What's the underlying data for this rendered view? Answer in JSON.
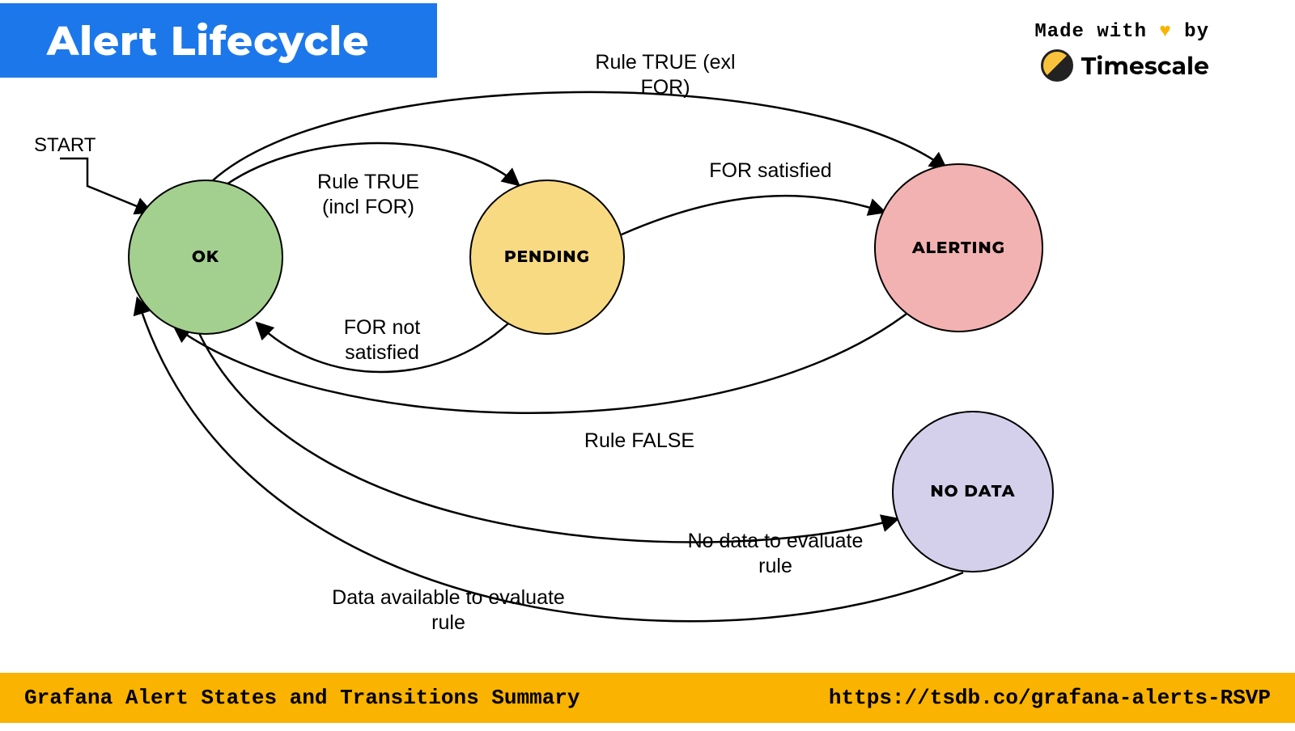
{
  "title": "Alert Lifecycle",
  "attribution": {
    "made_prefix": "Made with ",
    "made_suffix": " by",
    "brand": "Timescale"
  },
  "states": {
    "ok": "OK",
    "pending": "PENDING",
    "alerting": "ALERTING",
    "nodata": "NO DATA"
  },
  "labels": {
    "start": "START",
    "rule_true_incl": "Rule TRUE (incl FOR)",
    "rule_true_exl": "Rule TRUE (exl FOR)",
    "for_satisfied": "FOR satisfied",
    "for_not_satisfied": "FOR not satisfied",
    "rule_false": "Rule FALSE",
    "no_data_eval": "No data to evaluate rule",
    "data_avail": "Data available to evaluate rule"
  },
  "footer": {
    "left": "Grafana Alert States and Transitions Summary",
    "right": "https://tsdb.co/grafana-alerts-RSVP"
  },
  "transitions": [
    {
      "from": "START",
      "to": "OK",
      "label": "start"
    },
    {
      "from": "OK",
      "to": "PENDING",
      "label": "rule_true_incl"
    },
    {
      "from": "OK",
      "to": "ALERTING",
      "label": "rule_true_exl"
    },
    {
      "from": "PENDING",
      "to": "ALERTING",
      "label": "for_satisfied"
    },
    {
      "from": "PENDING",
      "to": "OK",
      "label": "for_not_satisfied"
    },
    {
      "from": "ALERTING",
      "to": "OK",
      "label": "rule_false"
    },
    {
      "from": "OK",
      "to": "NO DATA",
      "label": "no_data_eval"
    },
    {
      "from": "NO DATA",
      "to": "OK",
      "label": "data_avail"
    }
  ]
}
